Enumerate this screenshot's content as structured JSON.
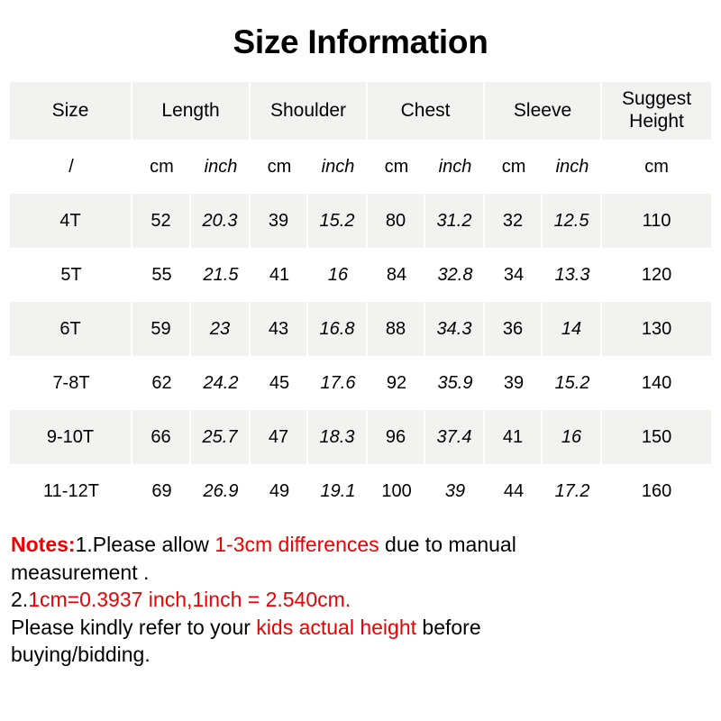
{
  "title": "Size Information",
  "colors": {
    "inch_blue": "#29abe2",
    "note_red": "#ee0000",
    "row_shade": "#f2f2f0",
    "header_shade": "#f2f2f0"
  },
  "table": {
    "headers": [
      "Size",
      "Length",
      "Shoulder",
      "Chest",
      "Sleeve",
      "Suggest\nHeight"
    ],
    "unit_row": {
      "size": "/",
      "length_cm": "cm",
      "length_inch": "inch",
      "shoulder_cm": "cm",
      "shoulder_inch": "inch",
      "chest_cm": "cm",
      "chest_inch": "inch",
      "sleeve_cm": "cm",
      "sleeve_inch": "inch",
      "suggest_height_cm": "cm"
    },
    "rows": [
      {
        "size": "4T",
        "length_cm": "52",
        "length_inch": "20.3",
        "shoulder_cm": "39",
        "shoulder_inch": "15.2",
        "chest_cm": "80",
        "chest_inch": "31.2",
        "sleeve_cm": "32",
        "sleeve_inch": "12.5",
        "suggest_height_cm": "110"
      },
      {
        "size": "5T",
        "length_cm": "55",
        "length_inch": "21.5",
        "shoulder_cm": "41",
        "shoulder_inch": "16",
        "chest_cm": "84",
        "chest_inch": "32.8",
        "sleeve_cm": "34",
        "sleeve_inch": "13.3",
        "suggest_height_cm": "120"
      },
      {
        "size": "6T",
        "length_cm": "59",
        "length_inch": "23",
        "shoulder_cm": "43",
        "shoulder_inch": "16.8",
        "chest_cm": "88",
        "chest_inch": "34.3",
        "sleeve_cm": "36",
        "sleeve_inch": "14",
        "suggest_height_cm": "130"
      },
      {
        "size": "7-8T",
        "length_cm": "62",
        "length_inch": "24.2",
        "shoulder_cm": "45",
        "shoulder_inch": "17.6",
        "chest_cm": "92",
        "chest_inch": "35.9",
        "sleeve_cm": "39",
        "sleeve_inch": "15.2",
        "suggest_height_cm": "140"
      },
      {
        "size": "9-10T",
        "length_cm": "66",
        "length_inch": "25.7",
        "shoulder_cm": "47",
        "shoulder_inch": "18.3",
        "chest_cm": "96",
        "chest_inch": "37.4",
        "sleeve_cm": "41",
        "sleeve_inch": "16",
        "suggest_height_cm": "150"
      },
      {
        "size": "11-12T",
        "length_cm": "69",
        "length_inch": "26.9",
        "shoulder_cm": "49",
        "shoulder_inch": "19.1",
        "chest_cm": "100",
        "chest_inch": "39",
        "sleeve_cm": "44",
        "sleeve_inch": "17.2",
        "suggest_height_cm": "160"
      }
    ]
  },
  "notes": {
    "label": "Notes:",
    "line1_a": "1.Please allow ",
    "line1_red": "1-3cm differences",
    "line1_b": " due to manual",
    "line2": "measurement .",
    "line3_prefix": "2.",
    "line3_red": "1cm=0.3937 inch,1inch = 2.540cm.",
    "line4_a": "Please kindly refer to your ",
    "line4_red": "kids actual height",
    "line4_b": " before",
    "line5": "buying/bidding."
  }
}
